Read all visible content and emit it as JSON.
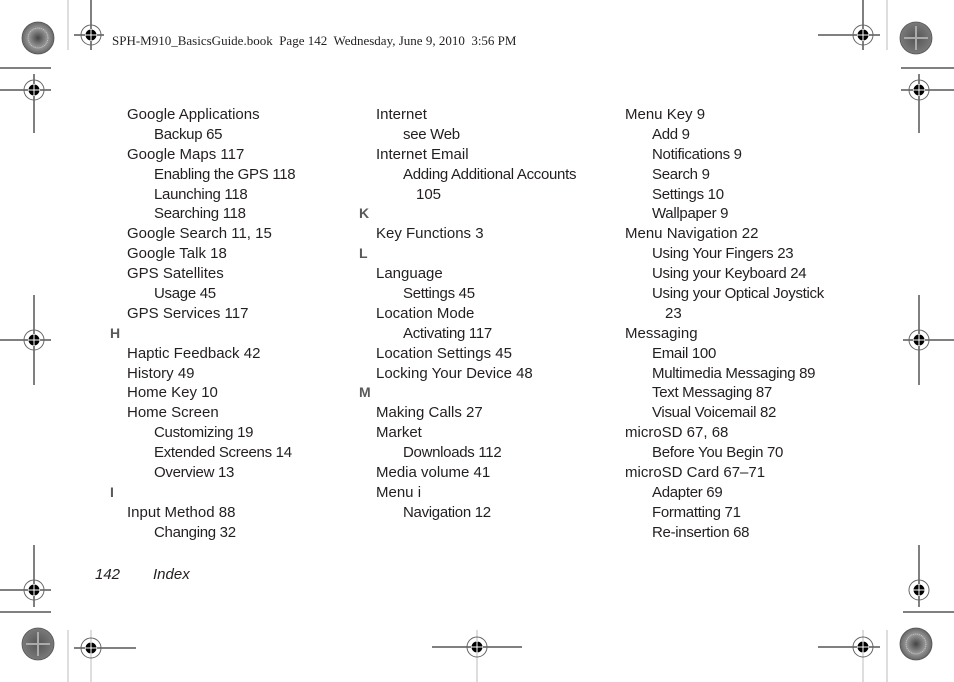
{
  "header": {
    "text": "SPH-M910_BasicsGuide.book  Page 142  Wednesday, June 9, 2010  3:56 PM"
  },
  "columns": [
    {
      "entries": [
        {
          "level": 0,
          "text": "Google Applications"
        },
        {
          "level": 1,
          "text": "Backup 65"
        },
        {
          "level": 0,
          "text": "Google Maps 117"
        },
        {
          "level": 1,
          "text": "Enabling the GPS 118"
        },
        {
          "level": 1,
          "text": "Launching 118"
        },
        {
          "level": 1,
          "text": "Searching 118"
        },
        {
          "level": 0,
          "text": "Google Search 11, 15"
        },
        {
          "level": 0,
          "text": "Google Talk 18"
        },
        {
          "level": 0,
          "text": "GPS Satellites"
        },
        {
          "level": 1,
          "text": "Usage 45"
        },
        {
          "level": 0,
          "text": "GPS Services 117"
        },
        {
          "level": "letter",
          "text": "H"
        },
        {
          "level": 0,
          "text": "Haptic Feedback 42"
        },
        {
          "level": 0,
          "text": "History 49"
        },
        {
          "level": 0,
          "text": "Home Key 10"
        },
        {
          "level": 0,
          "text": "Home Screen"
        },
        {
          "level": 1,
          "text": "Customizing 19"
        },
        {
          "level": 1,
          "text": "Extended Screens 14"
        },
        {
          "level": 1,
          "text": "Overview 13"
        },
        {
          "level": "letter",
          "text": "I"
        },
        {
          "level": 0,
          "text": "Input Method 88"
        },
        {
          "level": 1,
          "text": "Changing 32"
        }
      ]
    },
    {
      "entries": [
        {
          "level": 0,
          "text": "Internet"
        },
        {
          "level": 1,
          "text": "see Web"
        },
        {
          "level": 0,
          "text": "Internet Email"
        },
        {
          "level": 1,
          "text": "Adding Additional Accounts"
        },
        {
          "level": 2,
          "text": "105"
        },
        {
          "level": "letter",
          "text": "K"
        },
        {
          "level": 0,
          "text": "Key Functions 3"
        },
        {
          "level": "letter",
          "text": "L"
        },
        {
          "level": 0,
          "text": "Language"
        },
        {
          "level": 1,
          "text": "Settings 45"
        },
        {
          "level": 0,
          "text": "Location Mode"
        },
        {
          "level": 1,
          "text": "Activating 117"
        },
        {
          "level": 0,
          "text": "Location Settings 45"
        },
        {
          "level": 0,
          "text": "Locking Your Device 48"
        },
        {
          "level": "letter",
          "text": "M"
        },
        {
          "level": 0,
          "text": "Making Calls 27"
        },
        {
          "level": 0,
          "text": "Market"
        },
        {
          "level": 1,
          "text": "Downloads 112"
        },
        {
          "level": 0,
          "text": "Media volume 41"
        },
        {
          "level": 0,
          "text": "Menu i"
        },
        {
          "level": 1,
          "text": "Navigation 12"
        }
      ]
    },
    {
      "entries": [
        {
          "level": 0,
          "text": "Menu Key 9"
        },
        {
          "level": 1,
          "text": "Add 9"
        },
        {
          "level": 1,
          "text": "Notifications 9"
        },
        {
          "level": 1,
          "text": "Search 9"
        },
        {
          "level": 1,
          "text": "Settings 10"
        },
        {
          "level": 1,
          "text": "Wallpaper 9"
        },
        {
          "level": 0,
          "text": "Menu Navigation 22"
        },
        {
          "level": 1,
          "text": "Using Your Fingers 23"
        },
        {
          "level": 1,
          "text": "Using your Keyboard 24"
        },
        {
          "level": 1,
          "text": "Using your Optical Joystick"
        },
        {
          "level": 2,
          "text": "23"
        },
        {
          "level": 0,
          "text": "Messaging"
        },
        {
          "level": 1,
          "text": "Email 100"
        },
        {
          "level": 1,
          "text": "Multimedia Messaging 89"
        },
        {
          "level": 1,
          "text": "Text Messaging 87"
        },
        {
          "level": 1,
          "text": "Visual Voicemail 82"
        },
        {
          "level": 0,
          "text": "microSD 67, 68"
        },
        {
          "level": 1,
          "text": "Before You Begin 70"
        },
        {
          "level": 0,
          "text": "microSD Card 67–71"
        },
        {
          "level": 1,
          "text": "Adapter 69"
        },
        {
          "level": 1,
          "text": "Formatting 71"
        },
        {
          "level": 1,
          "text": "Re-insertion 68"
        }
      ]
    }
  ],
  "footer": {
    "page_number": "142",
    "section": "Index"
  },
  "icons": {
    "registration_mark": "registration-target-icon",
    "color_wheel": "color-calibration-wheel-icon"
  }
}
